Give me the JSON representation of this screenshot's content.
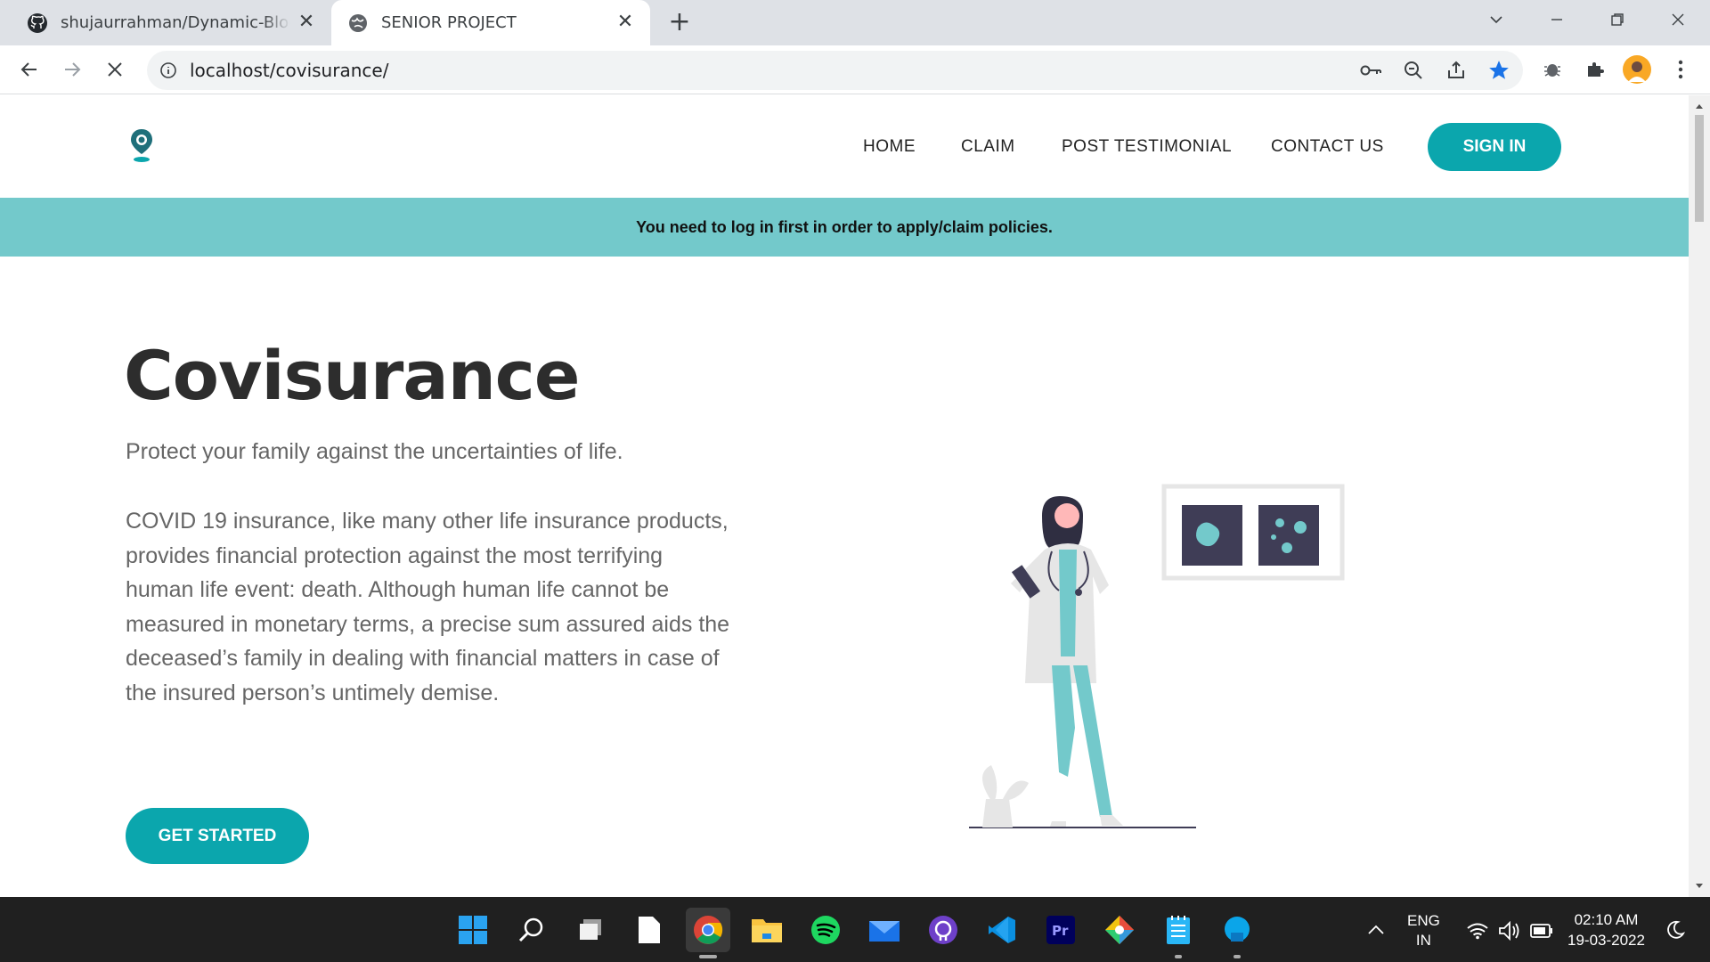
{
  "browser": {
    "tabs": [
      {
        "title": "shujaurrahman/Dynamic-Blogger"
      },
      {
        "title": "SENIOR PROJECT"
      }
    ],
    "url": "localhost/covisurance/"
  },
  "site": {
    "nav": {
      "home": "HOME",
      "claim": "CLAIM",
      "post_testimonial": "POST TESTIMONIAL",
      "contact": "CONTACT US",
      "signin": "SIGN IN"
    },
    "alert": "You need to log in first in order to apply/claim policies.",
    "hero": {
      "title": "Covisurance",
      "subtitle": "Protect your family against the uncertainties of life.",
      "body": "COVID 19 insurance, like many other life insurance products, provides financial protection against the most terrifying human life event: death. Although human life cannot be measured in monetary terms, a precise sum assured aids the deceased’s family in dealing with financial matters in case of the insured person’s untimely demise.",
      "cta": "GET STARTED"
    },
    "colors": {
      "accent": "#0ba6ad",
      "alert_bg": "#73c9cb"
    }
  },
  "taskbar": {
    "lang_top": "ENG",
    "lang_bottom": "IN",
    "time": "02:10 AM",
    "date": "19-03-2022"
  }
}
